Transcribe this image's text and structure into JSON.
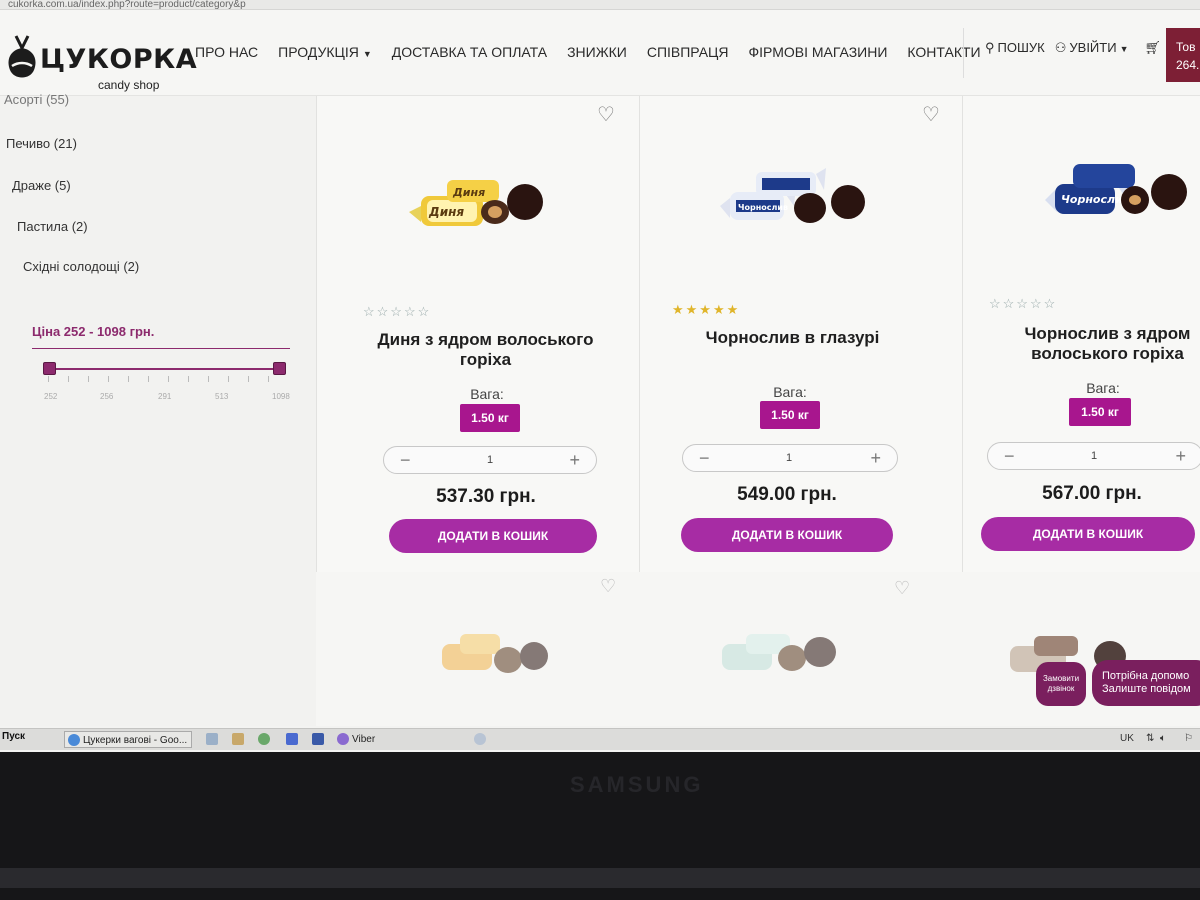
{
  "browser": {
    "url": "cukorka.com.ua/index.php?route=product/category&p"
  },
  "site": {
    "logo_name": "ЦУКОРКА",
    "logo_sub": "candy shop",
    "nav": [
      "ПРО НАС",
      "ПРОДУКЦІЯ",
      "ДОСТАВКА ТА ОПЛАТА",
      "ЗНИЖКИ",
      "СПІВПРАЦЯ",
      "ФІРМОВІ МАГАЗИНИ",
      "КОНТАКТИ"
    ],
    "search": "ПОШУК",
    "login": "УВІЙТИ",
    "cart_line1": "Тов",
    "cart_line2": "264."
  },
  "sidebar": {
    "cut_item": "Асорті (55)",
    "categories": [
      "Печиво (21)",
      "Драже (5)",
      "Пастила (2)",
      "Східні солодощі (2)"
    ],
    "price_filter": {
      "label": "Ціна  252 - 1098 грн.",
      "min": 252,
      "max": 1098,
      "tick_labels": [
        "252",
        "256",
        "291",
        "513",
        "1098"
      ]
    }
  },
  "products": [
    {
      "name": "Диня з ядром волоського горіха",
      "rating": 0,
      "weight_label": "Вага:",
      "weight": "1.50 кг",
      "qty": "1",
      "price": "537.30 грн.",
      "buy": "ДОДАТИ В КОШИК"
    },
    {
      "name": "Чорнослив в глазурі",
      "rating": 5,
      "weight_label": "Вага:",
      "weight": "1.50 кг",
      "qty": "1",
      "price": "549.00 грн.",
      "buy": "ДОДАТИ В КОШИК"
    },
    {
      "name": "Чорнослив з ядром волоського горіха",
      "rating": 0,
      "weight_label": "Вага:",
      "weight": "1.50 кг",
      "qty": "1",
      "price": "567.00 грн.",
      "buy": "ДОДАТИ В КОШИК"
    }
  ],
  "widgets": {
    "callback": "Замовити дзвінок",
    "help_line1": "Потрібна допомо",
    "help_line2": "Залиште повідом"
  },
  "taskbar": {
    "start": "Пуск",
    "active_window": "Цукерки вагові - Goo...",
    "viber": "Viber",
    "lang": "UK"
  },
  "monitor": {
    "brand": "SAMSUNG"
  },
  "colors": {
    "accent": "#a8168e",
    "brand_dark": "#7a1f5e",
    "cart": "#7d1f35"
  }
}
